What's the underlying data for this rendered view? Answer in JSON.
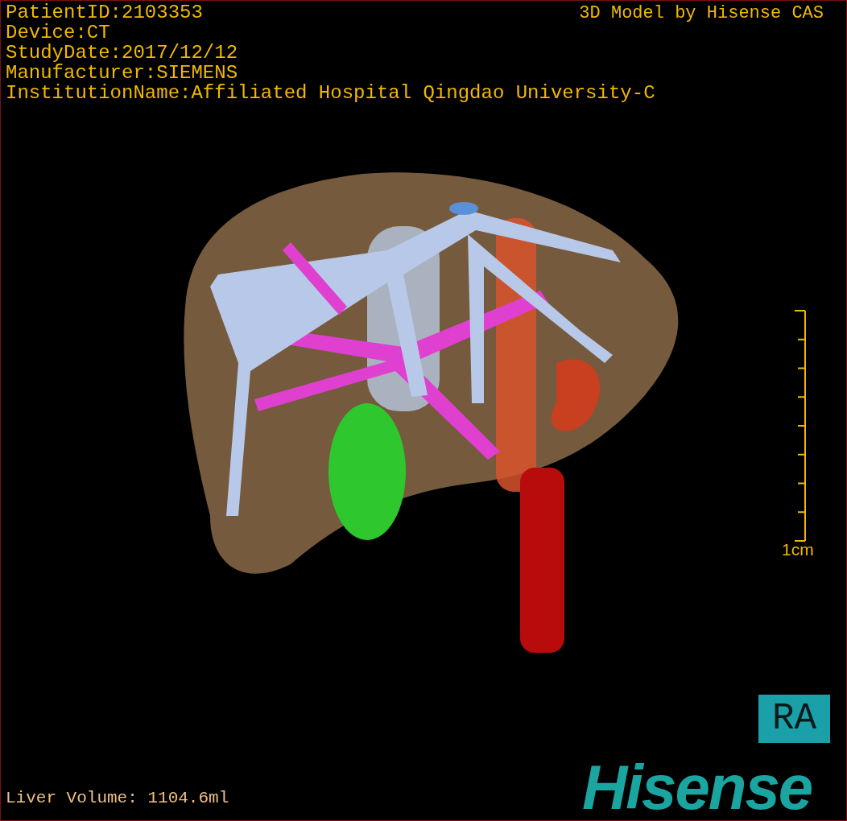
{
  "info_lines": [
    "PatientID:2103353",
    "Device:CT",
    "StudyDate:2017/12/12",
    "Manufacturer:SIEMENS",
    "InstitutionName:Affiliated Hospital Qingdao University-C"
  ],
  "credit": "3D Model by Hisense CAS",
  "scale": {
    "label": "1cm"
  },
  "orientation": "RA",
  "volume": "Liver Volume: 1104.6ml",
  "logo": "Hisense"
}
